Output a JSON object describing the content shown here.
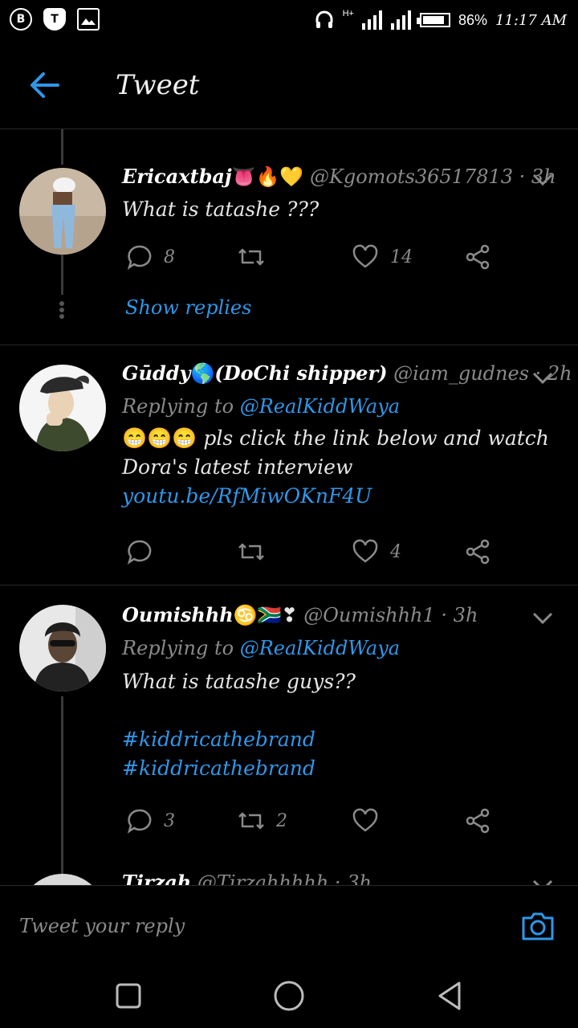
{
  "status_bar": {
    "left_icons": [
      "b-icon",
      "shield-icon",
      "image-icon"
    ],
    "network": "H+",
    "battery_percent": "86%",
    "battery_level": 0.86,
    "time": "11:17 AM"
  },
  "app": {
    "title": "Tweet"
  },
  "tweets": [
    {
      "name": "Ericaxtbaj",
      "emoji": "👅🔥💛",
      "handle": "@Kgomots36517813",
      "age": "· 3h",
      "text": "What is tatashe ???",
      "reply_count": "8",
      "retweet_count": "",
      "like_count": "14",
      "show_replies": "Show replies"
    },
    {
      "name": "Gūddy",
      "emoji": "🌎",
      "name_suffix": "(DoChi shipper)",
      "handle": "@iam_gudnes",
      "age": "· 2h",
      "replying_label": "Replying to",
      "replying_to": "@RealKiddWaya",
      "text_emoji": "😁😁😁",
      "text": " pls click the link below and watch Dora's latest interview",
      "link": "youtu.be/RfMiwOKnF4U",
      "reply_count": "",
      "retweet_count": "",
      "like_count": "4"
    },
    {
      "name": "Oumishhh",
      "emoji": "♋🇿🇦❣",
      "handle": "@Oumishhh1",
      "age": "· 3h",
      "replying_label": "Replying to",
      "replying_to": "@RealKiddWaya",
      "text": "What is tatashe guys??",
      "hashtag1": "#kiddricathebrand",
      "hashtag2": "#kiddricathebrand",
      "reply_count": "3",
      "retweet_count": "2",
      "like_count": ""
    },
    {
      "name": "Tirzah",
      "handle": "@Tirzahhhhh",
      "age": "· 3h"
    }
  ],
  "reply_bar": {
    "placeholder": "Tweet your reply"
  },
  "colors": {
    "accent": "#2f97e8",
    "background": "#000000",
    "muted": "#8a8a8a"
  }
}
